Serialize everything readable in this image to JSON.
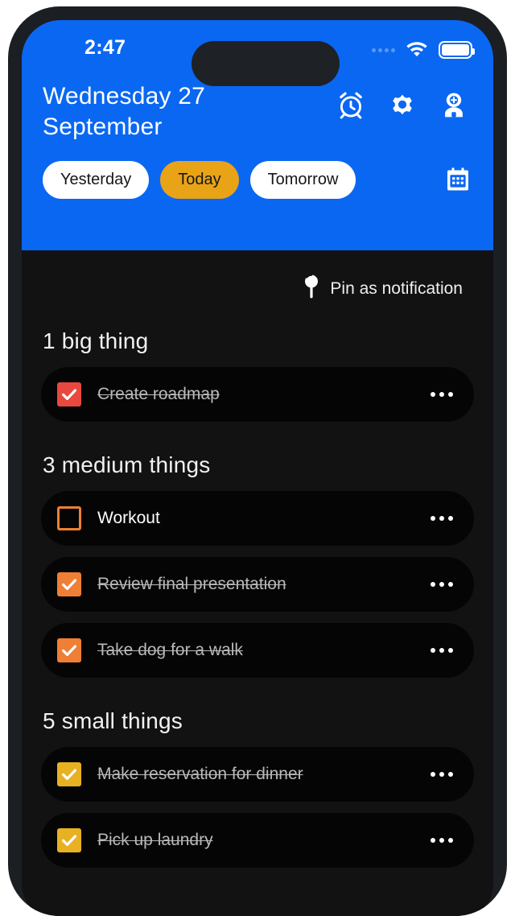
{
  "status_bar": {
    "time": "2:47",
    "signal_icon": "signal-dots-icon",
    "wifi_icon": "wifi-icon",
    "battery_icon": "battery-full-icon"
  },
  "header": {
    "title": "Wednesday 27 September",
    "background_color": "#0a67f2",
    "actions": [
      {
        "name": "alarm-icon",
        "label": "Alarm"
      },
      {
        "name": "settings-gear-icon",
        "label": "Settings"
      },
      {
        "name": "account-avatar-icon",
        "label": "Account"
      }
    ],
    "day_tabs": [
      {
        "label": "Yesterday",
        "active": false
      },
      {
        "label": "Today",
        "active": true
      },
      {
        "label": "Tomorrow",
        "active": false
      }
    ],
    "active_tab_color": "#e8a317",
    "calendar_icon": "calendar-icon"
  },
  "body": {
    "pin_notification": {
      "label": "Pin as notification",
      "icon": "pushpin-icon"
    },
    "sections": [
      {
        "title": "1 big thing",
        "accent_color": "#e8493f",
        "tasks": [
          {
            "label": "Create roadmap",
            "done": true,
            "menu": "•••"
          }
        ]
      },
      {
        "title": "3 medium things",
        "accent_color": "#ef7f34",
        "tasks": [
          {
            "label": "Workout",
            "done": false,
            "menu": "•••"
          },
          {
            "label": "Review final presentation",
            "done": true,
            "menu": "•••"
          },
          {
            "label": "Take dog for a walk",
            "done": true,
            "menu": "•••"
          }
        ]
      },
      {
        "title": "5 small things",
        "accent_color": "#e8b122",
        "tasks": [
          {
            "label": "Make reservation for dinner",
            "done": true,
            "menu": "•••"
          },
          {
            "label": "Pick up laundry",
            "done": true,
            "menu": "•••"
          }
        ]
      }
    ]
  }
}
